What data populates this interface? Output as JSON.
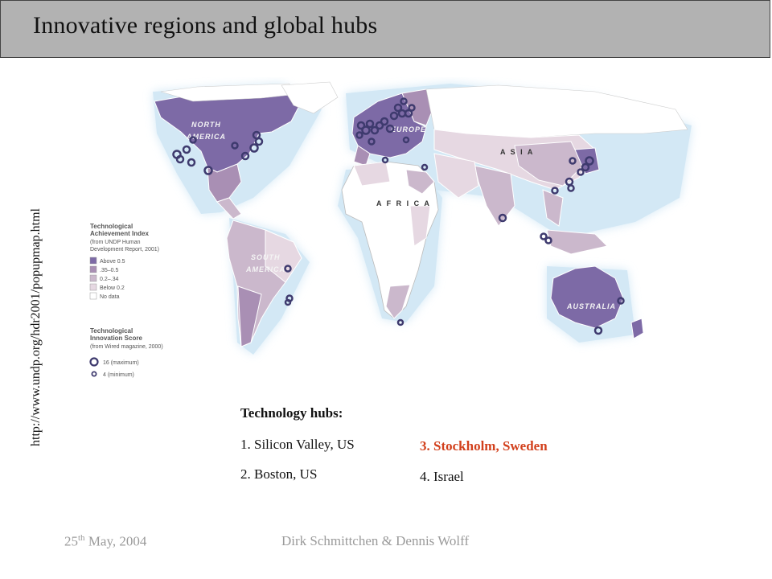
{
  "slide": {
    "title": "Innovative regions and global hubs",
    "source_url": "http://www.undp.org/hdr2001/popupmap.html"
  },
  "map": {
    "region_labels": {
      "north_america": [
        "NORTH",
        "AMERICA"
      ],
      "south_america": [
        "SOUTH",
        "AMERICA"
      ],
      "europe": "EUROPE",
      "asia": "A S I A",
      "africa": "A F R I C A",
      "australia": "AUSTRALIA"
    },
    "legend": {
      "tai_title": [
        "Technological",
        "Achievement Index"
      ],
      "tai_source": [
        "(from UNDP Human",
        "Development Report, 2001)"
      ],
      "tai_items": [
        {
          "label": "Above 0.5",
          "color": "#7d6aa6"
        },
        {
          "label": ".35–0.5",
          "color": "#a98fb4"
        },
        {
          "label": "0.2–.34",
          "color": "#cbb8cc"
        },
        {
          "label": "Below 0.2",
          "color": "#e6d8e2"
        },
        {
          "label": "No data",
          "color": "#ffffff"
        }
      ],
      "tis_title": [
        "Technological",
        "Innovation Score"
      ],
      "tis_source": "(from Wired magazine, 2000)",
      "tis_items": [
        {
          "label": "16 (maximum)"
        },
        {
          "label": "4 (minimum)"
        }
      ]
    },
    "colors": {
      "ocean_glow": "#cfe6f5",
      "hub_ring": "#3e3a6e"
    }
  },
  "hubs": {
    "title": "Technology hubs:",
    "items": [
      "1. Silicon Valley, US",
      "2. Boston, US",
      "3. Stockholm, Sweden",
      "4. Israel"
    ],
    "highlight_color": "#d2401c"
  },
  "footer": {
    "date_day": "25",
    "date_suffix": "th",
    "date_rest": " May, 2004",
    "authors": "Dirk Schmittchen & Dennis Wolff"
  }
}
